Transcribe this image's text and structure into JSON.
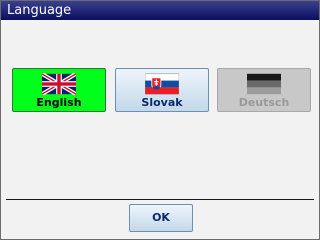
{
  "window": {
    "title": "Language"
  },
  "languages": [
    {
      "label": "English",
      "state": "selected",
      "flag_icon": "uk-flag-icon"
    },
    {
      "label": "Slovak",
      "state": "normal",
      "flag_icon": "slovak-flag-icon"
    },
    {
      "label": "Deutsch",
      "state": "disabled",
      "flag_icon": "german-flag-icon"
    }
  ],
  "buttons": {
    "ok": "OK"
  },
  "colors": {
    "titlebar": "#0a0f5e",
    "selected": "#00ff1a",
    "disabled": "#c8c8c8"
  }
}
